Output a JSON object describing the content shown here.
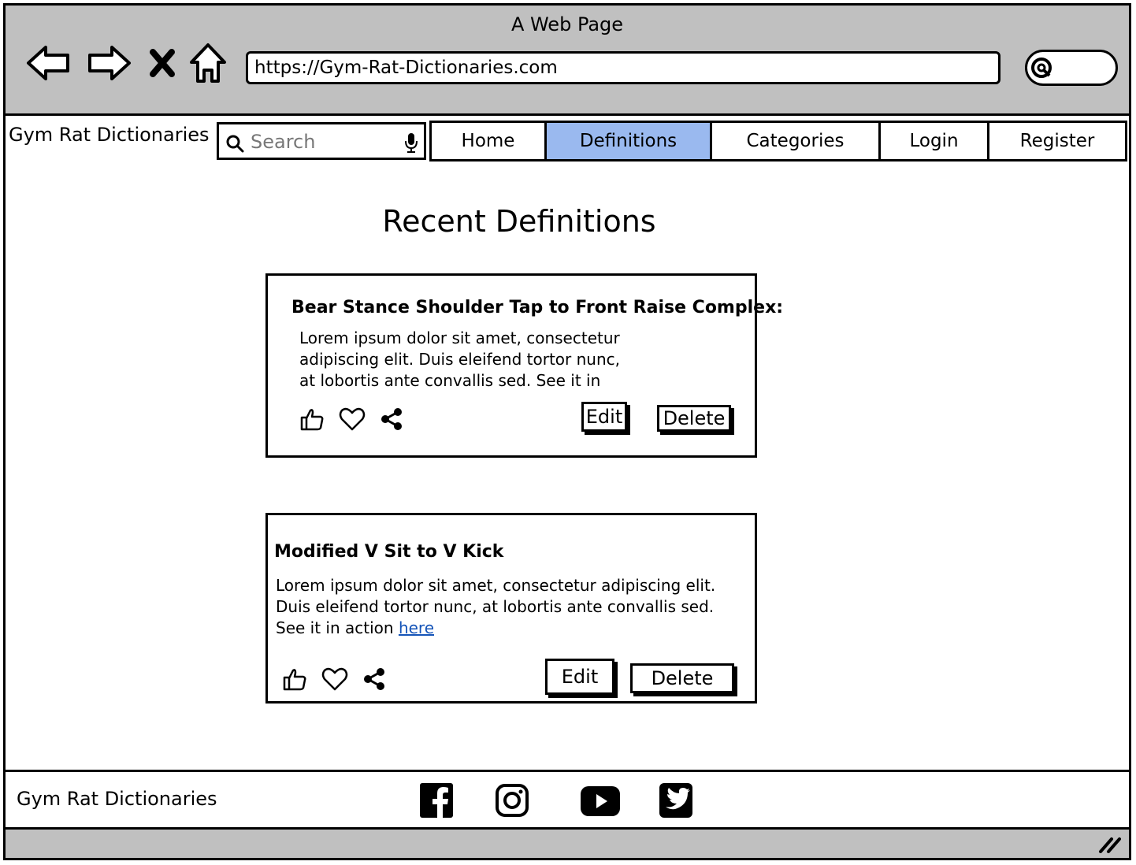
{
  "window": {
    "title": "A Web Page"
  },
  "browser": {
    "url": "https://Gym-Rat-Dictionaries.com",
    "icons": [
      "back-arrow-icon",
      "forward-arrow-icon",
      "close-x-icon",
      "home-icon",
      "search-icon"
    ]
  },
  "header": {
    "brand": "Gym Rat Dictionaries",
    "search_placeholder": "Search",
    "nav": [
      {
        "label": "Home",
        "active": false
      },
      {
        "label": "Definitions",
        "active": true
      },
      {
        "label": "Categories",
        "active": false
      },
      {
        "label": "Login",
        "active": false
      },
      {
        "label": "Register",
        "active": false
      }
    ],
    "active_color": "#9ab9ef"
  },
  "main": {
    "heading": "Recent Definitions",
    "cards": [
      {
        "title": "Bear Stance Shoulder Tap to Front Raise Complex:",
        "body_lines": [
          "Lorem ipsum dolor sit amet, consectetur",
          "adipiscing elit. Duis eleifend tortor nunc,",
          "at lobortis ante convallis sed. See it in"
        ],
        "edit_label": "Edit",
        "delete_label": "Delete"
      },
      {
        "title": "Modified V Sit to V Kick",
        "body_lines": [
          "Lorem ipsum dolor sit amet, consectetur adipiscing elit.",
          "Duis eleifend tortor nunc, at lobortis ante convallis sed."
        ],
        "body_last_prefix": "See it in action ",
        "link_text": "here",
        "edit_label": "Edit",
        "delete_label": "Delete"
      }
    ],
    "card_icons": [
      "thumbs-up-icon",
      "heart-icon",
      "share-icon"
    ]
  },
  "footer": {
    "brand": "Gym Rat Dictionaries",
    "social_icons": [
      "facebook-icon",
      "instagram-icon",
      "youtube-icon",
      "twitter-icon"
    ]
  }
}
